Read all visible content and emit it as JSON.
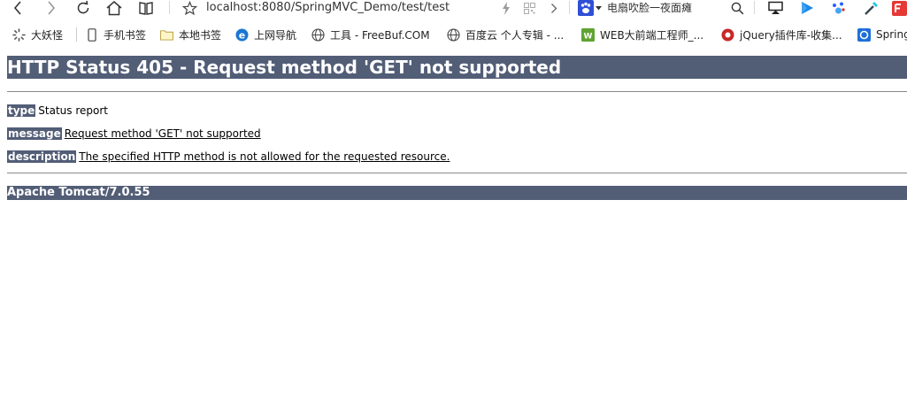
{
  "browser": {
    "url": "localhost:8080/SpringMVC_Demo/test/test",
    "search_engine_text": "电扇吹脸一夜面瘫"
  },
  "bookmarks": [
    {
      "label": "大妖怪",
      "icon": "spinner-icon"
    },
    {
      "label": "手机书签",
      "icon": "phone-icon"
    },
    {
      "label": "本地书签",
      "icon": "folder-icon"
    },
    {
      "label": "上网导航",
      "icon": "ie-icon"
    },
    {
      "label": "工具 - FreeBuf.COM",
      "icon": "globe-icon"
    },
    {
      "label": "百度云 个人专辑 - ...",
      "icon": "globe-icon"
    },
    {
      "label": "WEB大前端工程师_...",
      "icon": "green-badge-icon"
    },
    {
      "label": "jQuery插件库-收集...",
      "icon": "red-circle-icon"
    },
    {
      "label": "Spring",
      "icon": "blue-square-icon"
    }
  ],
  "page": {
    "title": "HTTP Status 405 - Request method 'GET' not supported",
    "rows": [
      {
        "label": "type",
        "value": "Status report",
        "underlined": false
      },
      {
        "label": "message",
        "value": "Request method 'GET' not supported",
        "underlined": true
      },
      {
        "label": "description",
        "value": "The specified HTTP method is not allowed for the requested resource.",
        "underlined": true
      }
    ],
    "footer": "Apache Tomcat/7.0.55"
  },
  "colors": {
    "tomcat_header_bg": "#525d76",
    "rule": "#8a8a8a"
  }
}
